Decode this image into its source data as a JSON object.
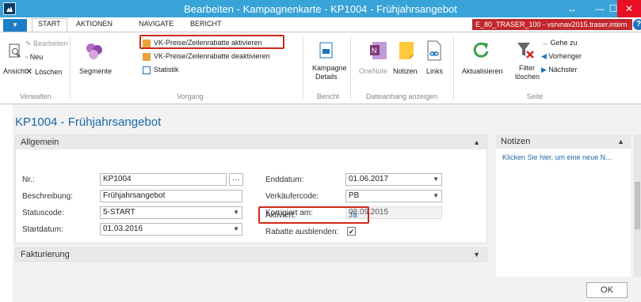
{
  "window": {
    "title": "Bearbeiten - Kampagnenkarte - KP1004 - Frühjahrsangebot"
  },
  "ribbon_tabs": [
    "START",
    "AKTIONEN",
    "NAVIGATE",
    "BERICHT"
  ],
  "server": "E_80_TRASER_100 - vsrvnav2015.traser.intern",
  "ribbon": {
    "verwalten": {
      "ansicht": "Ansicht",
      "bearbeiten": "Bearbeiten",
      "neu": "Neu",
      "loeschen": "Löschen",
      "label": "Verwalten"
    },
    "vorgang": {
      "segmente": "Segmente",
      "aktivieren": "VK-Preise/Zeilenrabatte aktivieren",
      "deaktivieren": "VK-Preise/Zeilenrabatte deaktivieren",
      "statistik": "Statistik",
      "label": "Vorgang"
    },
    "bericht": {
      "kampagne_line1": "Kampagne",
      "kampagne_line2": "Details",
      "label": "Bericht"
    },
    "dateianhang": {
      "onenote": "OneNote",
      "notizen": "Notizen",
      "links": "Links",
      "label": "Dateianhang anzeigen"
    },
    "seite": {
      "aktualisieren": "Aktualisieren",
      "filter_line1": "Filter",
      "filter_line2": "löschen",
      "gehe_zu": "Gehe zu",
      "vorheriger": "Vorheriger",
      "naechster": "Nächster",
      "label": "Seite"
    }
  },
  "page_title": "KP1004 - Frühjahrsangebot",
  "allgemein": {
    "header": "Allgemein",
    "nr_label": "Nr.:",
    "nr_value": "KP1004",
    "beschreibung_label": "Beschreibung:",
    "beschreibung_value": "Frühjahrsangebot",
    "statuscode_label": "Statuscode:",
    "statuscode_value": "5-START",
    "startdatum_label": "Startdatum:",
    "startdatum_value": "01.03.2016",
    "enddatum_label": "Enddatum:",
    "enddatum_value": "01.06.2017",
    "verkaeufercode_label": "Verkäufercode:",
    "verkaeufercode_value": "PB",
    "korrigiert_label": "Korrigiert am:",
    "korrigiert_value": "08.09.2015",
    "aktiviert_label": "Aktiviert:",
    "aktiviert_value": "Ja",
    "rabatte_label": "Rabatte ausblenden:",
    "rabatte_checked": true
  },
  "fakturierung": {
    "header": "Fakturierung"
  },
  "notizen": {
    "header": "Notizen",
    "link": "Klicken Sie hier, um eine neue N..."
  },
  "ok_button": "OK",
  "colors": {
    "titlebar": "#37a3d7",
    "accent": "#1c67a8",
    "highlight": "#d0281c",
    "server_badge": "#c1272d"
  }
}
